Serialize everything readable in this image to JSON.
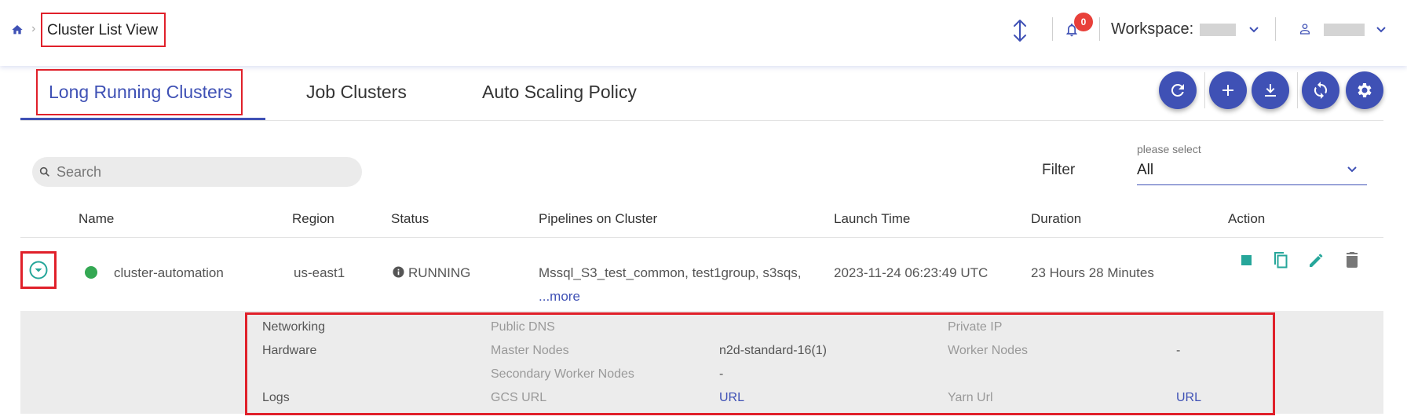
{
  "header": {
    "breadcrumb_current": "Cluster List View",
    "notification_count": "0",
    "workspace_label": "Workspace:"
  },
  "tabs": [
    {
      "label": "Long Running Clusters",
      "active": true
    },
    {
      "label": "Job Clusters",
      "active": false
    },
    {
      "label": "Auto Scaling Policy",
      "active": false
    }
  ],
  "toolbar": {
    "icons": [
      "refresh-icon",
      "add-icon",
      "download-icon",
      "sync-icon",
      "settings-icon"
    ]
  },
  "search": {
    "placeholder": "Search",
    "value": ""
  },
  "filter": {
    "label": "Filter",
    "caption": "please select",
    "value": "All"
  },
  "table": {
    "columns": [
      "Name",
      "Region",
      "Status",
      "Pipelines on Cluster",
      "Launch Time",
      "Duration",
      "Action"
    ],
    "rows": [
      {
        "name": "cluster-automation",
        "region": "us-east1",
        "status": "RUNNING",
        "pipelines": "Mssql_S3_test_common, test1group, s3sqs,",
        "more": "...more",
        "launch_time": "2023-11-24 06:23:49 UTC",
        "duration": "23 Hours 28 Minutes"
      }
    ]
  },
  "details": {
    "networking": {
      "label": "Networking",
      "public_dns": "Public DNS",
      "private_ip": "Private IP"
    },
    "hardware": {
      "label": "Hardware",
      "master_nodes": "Master Nodes",
      "master_nodes_value": "n2d-standard-16(1)",
      "worker_nodes": "Worker Nodes",
      "worker_nodes_value": "-",
      "secondary_worker_nodes": "Secondary Worker Nodes",
      "secondary_worker_nodes_value": "-"
    },
    "logs": {
      "label": "Logs",
      "gcs_url": "GCS URL",
      "gcs_url_value": "URL",
      "yarn_url": "Yarn Url",
      "yarn_url_value": "URL"
    }
  },
  "colors": {
    "accent": "#3f51b5",
    "running": "#34a853",
    "action_icon": "#26a69a",
    "badge": "#e8403a",
    "highlight": "#e0202a"
  }
}
